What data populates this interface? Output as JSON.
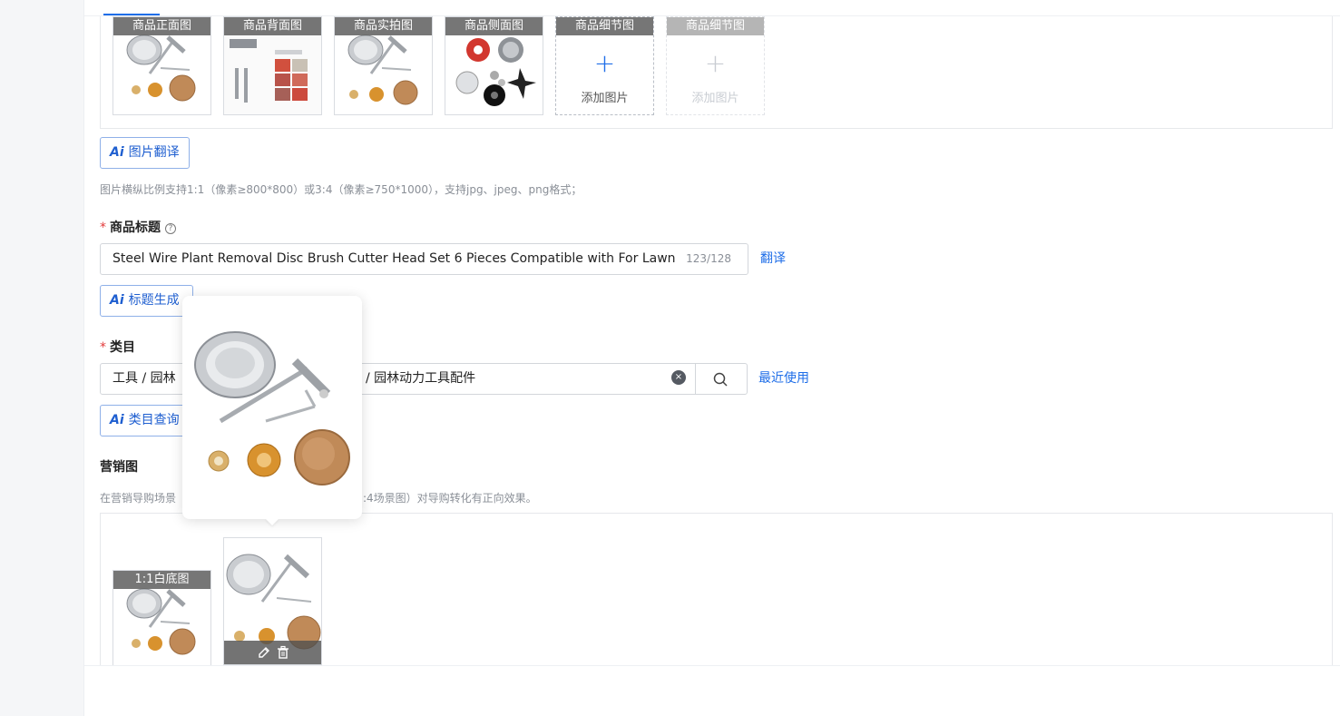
{
  "product_images": {
    "slots": [
      {
        "label": "商品正面图",
        "type": "image",
        "image": "tool-set-front"
      },
      {
        "label": "商品背面图",
        "type": "image",
        "image": "install-steps"
      },
      {
        "label": "商品实拍图",
        "type": "image",
        "image": "tool-set-real"
      },
      {
        "label": "商品侧面图",
        "type": "image",
        "image": "blade-variety"
      },
      {
        "label": "商品细节图",
        "type": "add",
        "add_text": "添加图片"
      },
      {
        "label": "商品细节图",
        "type": "add-disabled",
        "add_text": "添加图片"
      }
    ],
    "ai_translate_label": "图片翻译",
    "hint": "图片横纵比例支持1:1（像素≥800*800）或3:4（像素≥750*1000），支持jpg、jpeg、png格式；"
  },
  "title_field": {
    "label": "商品标题",
    "value": "Steel Wire Plant Removal Disc Brush Cutter Head Set 6 Pieces Compatible with For Lawn Mc",
    "counter": "123/128",
    "translate_link": "翻译",
    "ai_generate_label": "标题生成"
  },
  "category_field": {
    "label": "类目",
    "value_start": "工具 / 园林",
    "value_end": "/ 园林动力工具配件",
    "recent_link": "最近使用",
    "ai_query_label": "类目查询"
  },
  "marketing": {
    "label": "营销图",
    "hint_start": "在营销导购场景",
    "hint_end": ":4场景图）对导购转化有正向效果。",
    "slots": [
      {
        "label": "1:1白底图",
        "image": "tool-set-front"
      }
    ]
  },
  "icons": {
    "ai": "Ai",
    "help": "?",
    "clear": "×",
    "search": "search-icon",
    "plus": "+",
    "edit": "pencil-icon",
    "delete": "trash-icon"
  },
  "colors": {
    "accent": "#1f6ee8",
    "required": "#e23b3b",
    "label_overlay": "#505050"
  }
}
